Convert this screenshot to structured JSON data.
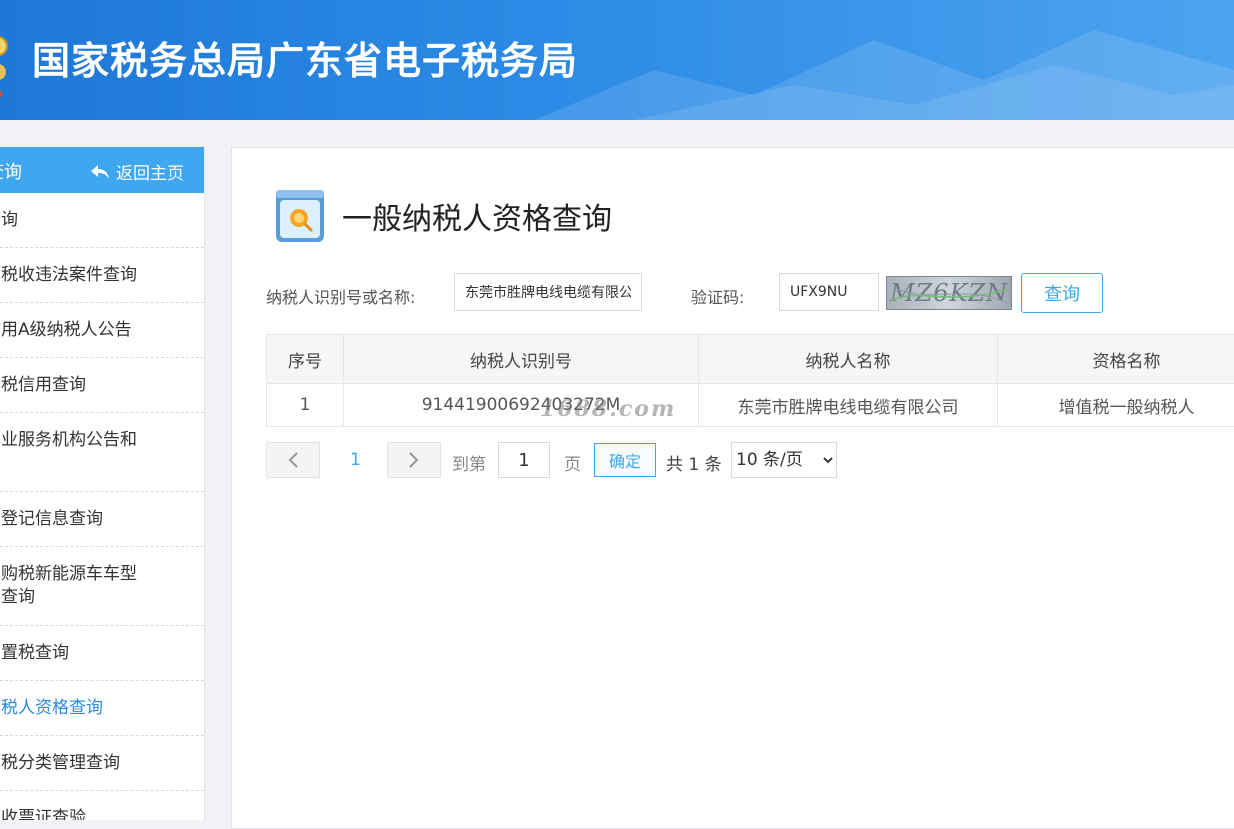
{
  "header": {
    "title": "国家税务总局广东省电子税务局"
  },
  "sidebar": {
    "title": "查询",
    "back_label": "返回主页",
    "items": [
      {
        "label": "查询"
      },
      {
        "label": "大税收违法案件查询"
      },
      {
        "label": "信用A级纳税人公告"
      },
      {
        "label": "纳税信用查询"
      },
      {
        "label": "专业服务机构公告和\n询"
      },
      {
        "label": "务登记信息查询"
      },
      {
        "label": "车购税新能源车车型\n录查询"
      },
      {
        "label": "购置税查询"
      },
      {
        "label": "纳税人资格查询"
      },
      {
        "label": "退税分类管理查询"
      },
      {
        "label": "税收票证查验"
      }
    ]
  },
  "main": {
    "title": "一般纳税人资格查询",
    "form": {
      "taxpayer_label": "纳税人识别号或名称:",
      "taxpayer_value": "东莞市胜牌电线电缆有限公司",
      "captcha_label": "验证码:",
      "captcha_value": "UFX9NU",
      "captcha_image_text": "MZ6KZN",
      "query_label": "查询"
    },
    "table": {
      "headers": [
        "序号",
        "纳税人识别号",
        "纳税人名称",
        "资格名称"
      ],
      "rows": [
        {
          "index": "1",
          "tax_id": "91441900692403272M",
          "name": "东莞市胜牌电线电缆有限公司",
          "qualification": "增值税一般纳税人"
        }
      ]
    },
    "watermark": "1688.com",
    "pagination": {
      "current_page": "1",
      "goto_label": "到第",
      "goto_value": "1",
      "page_unit": "页",
      "confirm_label": "确定",
      "total_text": "共 1 条",
      "page_size": "10 条/页"
    }
  }
}
